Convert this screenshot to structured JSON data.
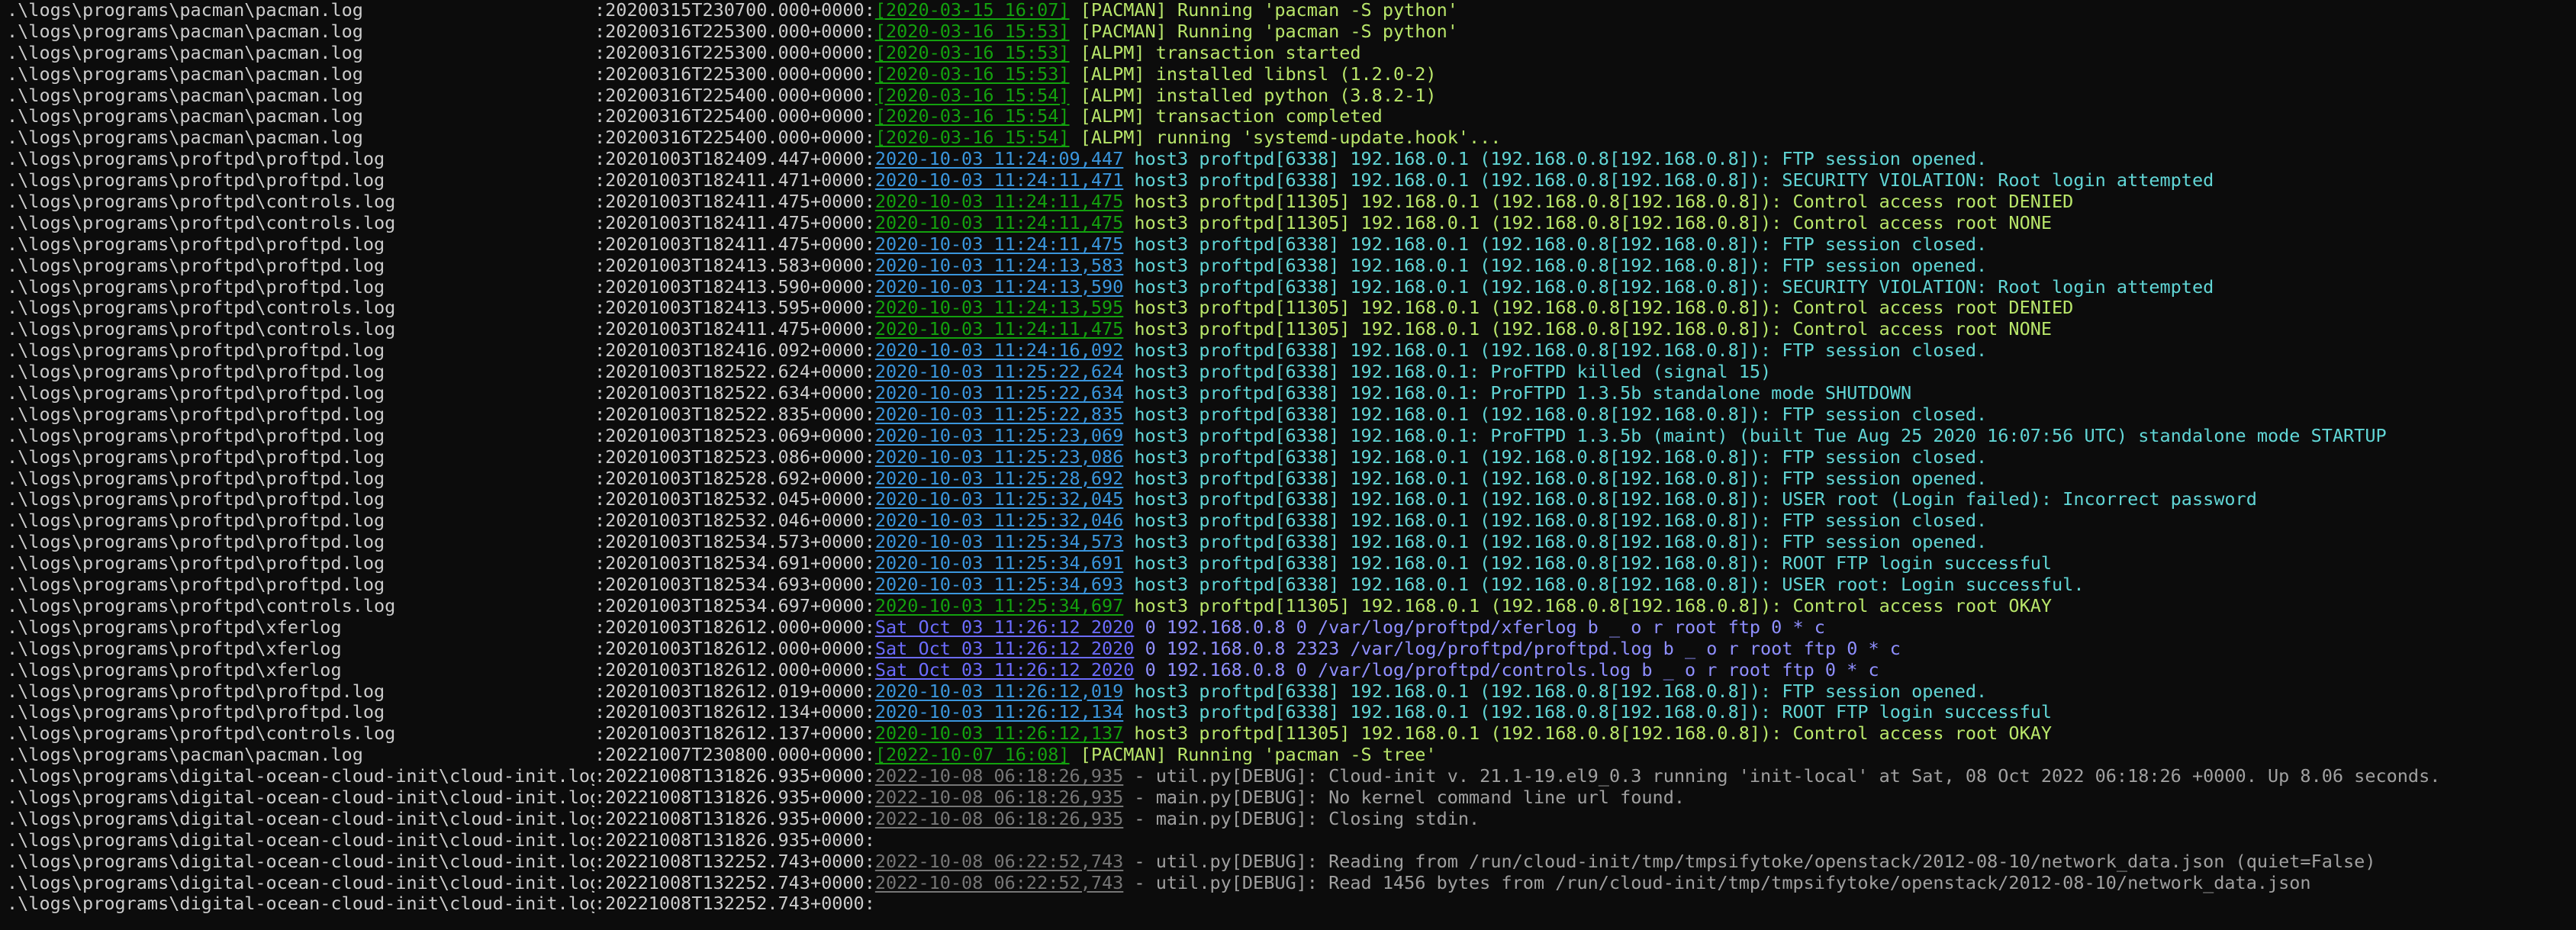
{
  "lines": [
    {
      "path": ".\\logs\\programs\\pacman\\pacman.log",
      "ts": ":20200315T230700.000+0000:",
      "dt": "[2020-03-15 16:07]",
      "msg": " [PACMAN] Running 'pacman -S python'",
      "c": "green"
    },
    {
      "path": ".\\logs\\programs\\pacman\\pacman.log",
      "ts": ":20200316T225300.000+0000:",
      "dt": "[2020-03-16 15:53]",
      "msg": " [PACMAN] Running 'pacman -S python'",
      "c": "green"
    },
    {
      "path": ".\\logs\\programs\\pacman\\pacman.log",
      "ts": ":20200316T225300.000+0000:",
      "dt": "[2020-03-16 15:53]",
      "msg": " [ALPM] transaction started",
      "c": "green"
    },
    {
      "path": ".\\logs\\programs\\pacman\\pacman.log",
      "ts": ":20200316T225300.000+0000:",
      "dt": "[2020-03-16 15:53]",
      "msg": " [ALPM] installed libnsl (1.2.0-2)",
      "c": "green"
    },
    {
      "path": ".\\logs\\programs\\pacman\\pacman.log",
      "ts": ":20200316T225400.000+0000:",
      "dt": "[2020-03-16 15:54]",
      "msg": " [ALPM] installed python (3.8.2-1)",
      "c": "green"
    },
    {
      "path": ".\\logs\\programs\\pacman\\pacman.log",
      "ts": ":20200316T225400.000+0000:",
      "dt": "[2020-03-16 15:54]",
      "msg": " [ALPM] transaction completed",
      "c": "green"
    },
    {
      "path": ".\\logs\\programs\\pacman\\pacman.log",
      "ts": ":20200316T225400.000+0000:",
      "dt": "[2020-03-16 15:54]",
      "msg": " [ALPM] running 'systemd-update.hook'...",
      "c": "green"
    },
    {
      "path": ".\\logs\\programs\\proftpd\\proftpd.log",
      "ts": ":20201003T182409.447+0000:",
      "dt": "2020-10-03 11:24:09,447",
      "msg": " host3 proftpd[6338] 192.168.0.1 (192.168.0.8[192.168.0.8]): FTP session opened.",
      "c": "cyan"
    },
    {
      "path": ".\\logs\\programs\\proftpd\\proftpd.log",
      "ts": ":20201003T182411.471+0000:",
      "dt": "2020-10-03 11:24:11,471",
      "msg": " host3 proftpd[6338] 192.168.0.1 (192.168.0.8[192.168.0.8]): SECURITY VIOLATION: Root login attempted",
      "c": "cyan"
    },
    {
      "path": ".\\logs\\programs\\proftpd\\controls.log",
      "ts": ":20201003T182411.475+0000:",
      "dt": "2020-10-03 11:24:11,475",
      "msg": " host3 proftpd[11305] 192.168.0.1 (192.168.0.8[192.168.0.8]): Control access root DENIED",
      "c": "green"
    },
    {
      "path": ".\\logs\\programs\\proftpd\\controls.log",
      "ts": ":20201003T182411.475+0000:",
      "dt": "2020-10-03 11:24:11,475",
      "msg": " host3 proftpd[11305] 192.168.0.1 (192.168.0.8[192.168.0.8]): Control access root NONE",
      "c": "green"
    },
    {
      "path": ".\\logs\\programs\\proftpd\\proftpd.log",
      "ts": ":20201003T182411.475+0000:",
      "dt": "2020-10-03 11:24:11,475",
      "msg": " host3 proftpd[6338] 192.168.0.1 (192.168.0.8[192.168.0.8]): FTP session closed.",
      "c": "cyan"
    },
    {
      "path": ".\\logs\\programs\\proftpd\\proftpd.log",
      "ts": ":20201003T182413.583+0000:",
      "dt": "2020-10-03 11:24:13,583",
      "msg": " host3 proftpd[6338] 192.168.0.1 (192.168.0.8[192.168.0.8]): FTP session opened.",
      "c": "cyan"
    },
    {
      "path": ".\\logs\\programs\\proftpd\\proftpd.log",
      "ts": ":20201003T182413.590+0000:",
      "dt": "2020-10-03 11:24:13,590",
      "msg": " host3 proftpd[6338] 192.168.0.1 (192.168.0.8[192.168.0.8]): SECURITY VIOLATION: Root login attempted",
      "c": "cyan"
    },
    {
      "path": ".\\logs\\programs\\proftpd\\controls.log",
      "ts": ":20201003T182413.595+0000:",
      "dt": "2020-10-03 11:24:13,595",
      "msg": " host3 proftpd[11305] 192.168.0.1 (192.168.0.8[192.168.0.8]): Control access root DENIED",
      "c": "green"
    },
    {
      "path": ".\\logs\\programs\\proftpd\\controls.log",
      "ts": ":20201003T182411.475+0000:",
      "dt": "2020-10-03 11:24:11,475",
      "msg": " host3 proftpd[11305] 192.168.0.1 (192.168.0.8[192.168.0.8]): Control access root NONE",
      "c": "green"
    },
    {
      "path": ".\\logs\\programs\\proftpd\\proftpd.log",
      "ts": ":20201003T182416.092+0000:",
      "dt": "2020-10-03 11:24:16,092",
      "msg": " host3 proftpd[6338] 192.168.0.1 (192.168.0.8[192.168.0.8]): FTP session closed.",
      "c": "cyan"
    },
    {
      "path": ".\\logs\\programs\\proftpd\\proftpd.log",
      "ts": ":20201003T182522.624+0000:",
      "dt": "2020-10-03 11:25:22,624",
      "msg": " host3 proftpd[6338] 192.168.0.1: ProFTPD killed (signal 15)",
      "c": "cyan"
    },
    {
      "path": ".\\logs\\programs\\proftpd\\proftpd.log",
      "ts": ":20201003T182522.634+0000:",
      "dt": "2020-10-03 11:25:22,634",
      "msg": " host3 proftpd[6338] 192.168.0.1: ProFTPD 1.3.5b standalone mode SHUTDOWN",
      "c": "cyan"
    },
    {
      "path": ".\\logs\\programs\\proftpd\\proftpd.log",
      "ts": ":20201003T182522.835+0000:",
      "dt": "2020-10-03 11:25:22,835",
      "msg": " host3 proftpd[6338] 192.168.0.1 (192.168.0.8[192.168.0.8]): FTP session closed.",
      "c": "cyan"
    },
    {
      "path": ".\\logs\\programs\\proftpd\\proftpd.log",
      "ts": ":20201003T182523.069+0000:",
      "dt": "2020-10-03 11:25:23,069",
      "msg": " host3 proftpd[6338] 192.168.0.1: ProFTPD 1.3.5b (maint) (built Tue Aug 25 2020 16:07:56 UTC) standalone mode STARTUP",
      "c": "cyan"
    },
    {
      "path": ".\\logs\\programs\\proftpd\\proftpd.log",
      "ts": ":20201003T182523.086+0000:",
      "dt": "2020-10-03 11:25:23,086",
      "msg": " host3 proftpd[6338] 192.168.0.1 (192.168.0.8[192.168.0.8]): FTP session closed.",
      "c": "cyan"
    },
    {
      "path": ".\\logs\\programs\\proftpd\\proftpd.log",
      "ts": ":20201003T182528.692+0000:",
      "dt": "2020-10-03 11:25:28,692",
      "msg": " host3 proftpd[6338] 192.168.0.1 (192.168.0.8[192.168.0.8]): FTP session opened.",
      "c": "cyan"
    },
    {
      "path": ".\\logs\\programs\\proftpd\\proftpd.log",
      "ts": ":20201003T182532.045+0000:",
      "dt": "2020-10-03 11:25:32,045",
      "msg": " host3 proftpd[6338] 192.168.0.1 (192.168.0.8[192.168.0.8]): USER root (Login failed): Incorrect password",
      "c": "cyan"
    },
    {
      "path": ".\\logs\\programs\\proftpd\\proftpd.log",
      "ts": ":20201003T182532.046+0000:",
      "dt": "2020-10-03 11:25:32,046",
      "msg": " host3 proftpd[6338] 192.168.0.1 (192.168.0.8[192.168.0.8]): FTP session closed.",
      "c": "cyan"
    },
    {
      "path": ".\\logs\\programs\\proftpd\\proftpd.log",
      "ts": ":20201003T182534.573+0000:",
      "dt": "2020-10-03 11:25:34,573",
      "msg": " host3 proftpd[6338] 192.168.0.1 (192.168.0.8[192.168.0.8]): FTP session opened.",
      "c": "cyan"
    },
    {
      "path": ".\\logs\\programs\\proftpd\\proftpd.log",
      "ts": ":20201003T182534.691+0000:",
      "dt": "2020-10-03 11:25:34,691",
      "msg": " host3 proftpd[6338] 192.168.0.1 (192.168.0.8[192.168.0.8]): ROOT FTP login successful",
      "c": "cyan"
    },
    {
      "path": ".\\logs\\programs\\proftpd\\proftpd.log",
      "ts": ":20201003T182534.693+0000:",
      "dt": "2020-10-03 11:25:34,693",
      "msg": " host3 proftpd[6338] 192.168.0.1 (192.168.0.8[192.168.0.8]): USER root: Login successful.",
      "c": "cyan"
    },
    {
      "path": ".\\logs\\programs\\proftpd\\controls.log",
      "ts": ":20201003T182534.697+0000:",
      "dt": "2020-10-03 11:25:34,697",
      "msg": " host3 proftpd[11305] 192.168.0.1 (192.168.0.8[192.168.0.8]): Control access root OKAY",
      "c": "green"
    },
    {
      "path": ".\\logs\\programs\\proftpd\\xferlog",
      "ts": ":20201003T182612.000+0000:",
      "dt": "Sat Oct 03 11:26:12 2020",
      "msg": " 0 192.168.0.8 0 /var/log/proftpd/xferlog b _ o r root ftp 0 * c",
      "c": "purple"
    },
    {
      "path": ".\\logs\\programs\\proftpd\\xferlog",
      "ts": ":20201003T182612.000+0000:",
      "dt": "Sat Oct 03 11:26:12 2020",
      "msg": " 0 192.168.0.8 2323 /var/log/proftpd/proftpd.log b _ o r root ftp 0 * c",
      "c": "purple"
    },
    {
      "path": ".\\logs\\programs\\proftpd\\xferlog",
      "ts": ":20201003T182612.000+0000:",
      "dt": "Sat Oct 03 11:26:12 2020",
      "msg": " 0 192.168.0.8 0 /var/log/proftpd/controls.log b _ o r root ftp 0 * c",
      "c": "purple"
    },
    {
      "path": ".\\logs\\programs\\proftpd\\proftpd.log",
      "ts": ":20201003T182612.019+0000:",
      "dt": "2020-10-03 11:26:12,019",
      "msg": " host3 proftpd[6338] 192.168.0.1 (192.168.0.8[192.168.0.8]): FTP session opened.",
      "c": "cyan"
    },
    {
      "path": ".\\logs\\programs\\proftpd\\proftpd.log",
      "ts": ":20201003T182612.134+0000:",
      "dt": "2020-10-03 11:26:12,134",
      "msg": " host3 proftpd[6338] 192.168.0.1 (192.168.0.8[192.168.0.8]): ROOT FTP login successful",
      "c": "cyan"
    },
    {
      "path": ".\\logs\\programs\\proftpd\\controls.log",
      "ts": ":20201003T182612.137+0000:",
      "dt": "2020-10-03 11:26:12,137",
      "msg": " host3 proftpd[11305] 192.168.0.1 (192.168.0.8[192.168.0.8]): Control access root OKAY",
      "c": "green"
    },
    {
      "path": ".\\logs\\programs\\pacman\\pacman.log",
      "ts": ":20221007T230800.000+0000:",
      "dt": "[2022-10-07 16:08]",
      "msg": " [PACMAN] Running 'pacman -S tree'",
      "c": "green"
    },
    {
      "path": ".\\logs\\programs\\digital-ocean-cloud-init\\cloud-init.log",
      "ts": ":20221008T131826.935+0000:",
      "dt": "2022-10-08 06:18:26,935",
      "msg": " - util.py[DEBUG]: Cloud-init v. 21.1-19.el9_0.3 running 'init-local' at Sat, 08 Oct 2022 06:18:26 +0000. Up 8.06 seconds.",
      "c": "gray"
    },
    {
      "path": ".\\logs\\programs\\digital-ocean-cloud-init\\cloud-init.log",
      "ts": ":20221008T131826.935+0000:",
      "dt": "2022-10-08 06:18:26,935",
      "msg": " - main.py[DEBUG]: No kernel command line url found.",
      "c": "gray"
    },
    {
      "path": ".\\logs\\programs\\digital-ocean-cloud-init\\cloud-init.log",
      "ts": ":20221008T131826.935+0000:",
      "dt": "2022-10-08 06:18:26,935",
      "msg": " - main.py[DEBUG]: Closing stdin.",
      "c": "gray"
    },
    {
      "path": ".\\logs\\programs\\digital-ocean-cloud-init\\cloud-init.log",
      "ts": ":20221008T131826.935+0000:",
      "dt": "",
      "msg": "",
      "c": "gray"
    },
    {
      "path": ".\\logs\\programs\\digital-ocean-cloud-init\\cloud-init.log",
      "ts": ":20221008T132252.743+0000:",
      "dt": "2022-10-08 06:22:52,743",
      "msg": " - util.py[DEBUG]: Reading from /run/cloud-init/tmp/tmpsifytoke/openstack/2012-08-10/network_data.json (quiet=False)",
      "c": "gray"
    },
    {
      "path": ".\\logs\\programs\\digital-ocean-cloud-init\\cloud-init.log",
      "ts": ":20221008T132252.743+0000:",
      "dt": "2022-10-08 06:22:52,743",
      "msg": " - util.py[DEBUG]: Read 1456 bytes from /run/cloud-init/tmp/tmpsifytoke/openstack/2012-08-10/network_data.json",
      "c": "gray"
    },
    {
      "path": ".\\logs\\programs\\digital-ocean-cloud-init\\cloud-init.log",
      "ts": ":20221008T132252.743+0000:",
      "dt": "",
      "msg": "",
      "c": "gray"
    }
  ]
}
